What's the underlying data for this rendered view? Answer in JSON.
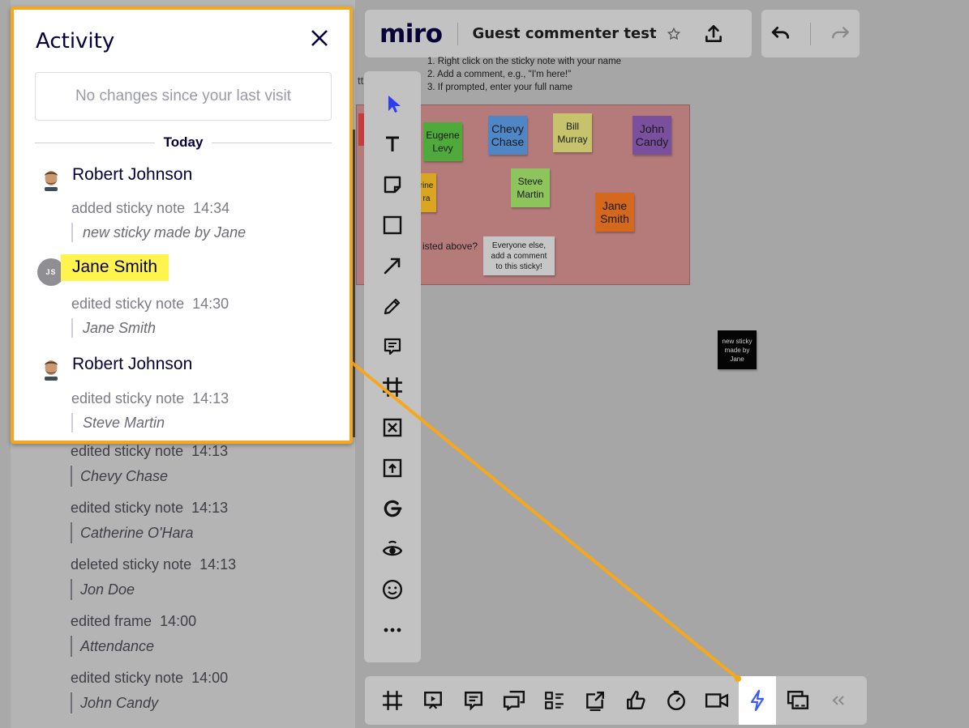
{
  "topbar": {
    "logo": "miro",
    "board_title": "Guest commenter test",
    "star_icon": "star-icon",
    "upload_icon": "upload-icon",
    "undo_icon": "undo-icon",
    "redo_icon": "redo-icon"
  },
  "board": {
    "instructions": [
      "1. Right click on the sticky note with your name",
      "2. Add a comment, e.g., \"I'm here!\"",
      "3. If prompted, enter your full name"
    ],
    "frame_label": "tt",
    "other_question": "isted above?",
    "stickies": [
      {
        "text": "Eugene\nLevy",
        "color": "#4eaa3a"
      },
      {
        "text": "Chevy\nChase",
        "color": "#4f86c6"
      },
      {
        "text": "Bill\nMurray",
        "color": "#c6c36c"
      },
      {
        "text": "John\nCandy",
        "color": "#7a4f9e"
      },
      {
        "text": "rine\nra",
        "color": "#d9a622"
      },
      {
        "text": "Steve\nMartin",
        "color": "#8ec45c"
      },
      {
        "text": "Jane\nSmith",
        "color": "#d4681c"
      },
      {
        "text": "Everyone else,\nadd a comment\nto this sticky!",
        "color": "#c6c6c6"
      },
      {
        "text": "new sticky\nmade by\nJane",
        "color": "#050505"
      }
    ]
  },
  "toolbar": {
    "tools": [
      "select-icon",
      "text-icon",
      "sticky-note-icon",
      "shape-icon",
      "connection-line-icon",
      "pen-icon",
      "comment-icon",
      "frame-icon",
      "crop-icon",
      "upload-icon",
      "google-icon",
      "eye-icon",
      "emoji-icon",
      "more-icon"
    ]
  },
  "bottombar": {
    "items": [
      "frames-icon",
      "presentation-icon",
      "comments-icon",
      "chat-icon",
      "cards-icon",
      "share-screen-icon",
      "voting-icon",
      "timer-icon",
      "video-icon",
      "activity-icon",
      "card-view-icon",
      "collapse-icon"
    ]
  },
  "activity": {
    "title": "Activity",
    "no_changes": "No changes since your last visit",
    "today_label": "Today",
    "entries": [
      {
        "user": "Robert Johnson",
        "action": "added sticky note",
        "time": "14:34",
        "object": "new sticky made by Jane"
      },
      {
        "user": "Jane Smith",
        "avatar_initials": "JS",
        "action": "edited sticky note",
        "time": "14:30",
        "object": "Jane Smith"
      },
      {
        "user": "Robert Johnson",
        "action": "edited sticky note",
        "time": "14:13",
        "object": "Steve Martin"
      }
    ],
    "more_entries": [
      {
        "action": "edited sticky note",
        "time": "14:13",
        "object": "Chevy Chase"
      },
      {
        "action": "edited sticky note",
        "time": "14:13",
        "object": "Catherine O'Hara"
      },
      {
        "action": "deleted sticky note",
        "time": "14:13",
        "object": "Jon Doe"
      },
      {
        "action": "edited frame",
        "time": "14:00",
        "object": "Attendance"
      },
      {
        "action": "edited sticky note",
        "time": "14:00",
        "object": "John Candy"
      }
    ]
  }
}
